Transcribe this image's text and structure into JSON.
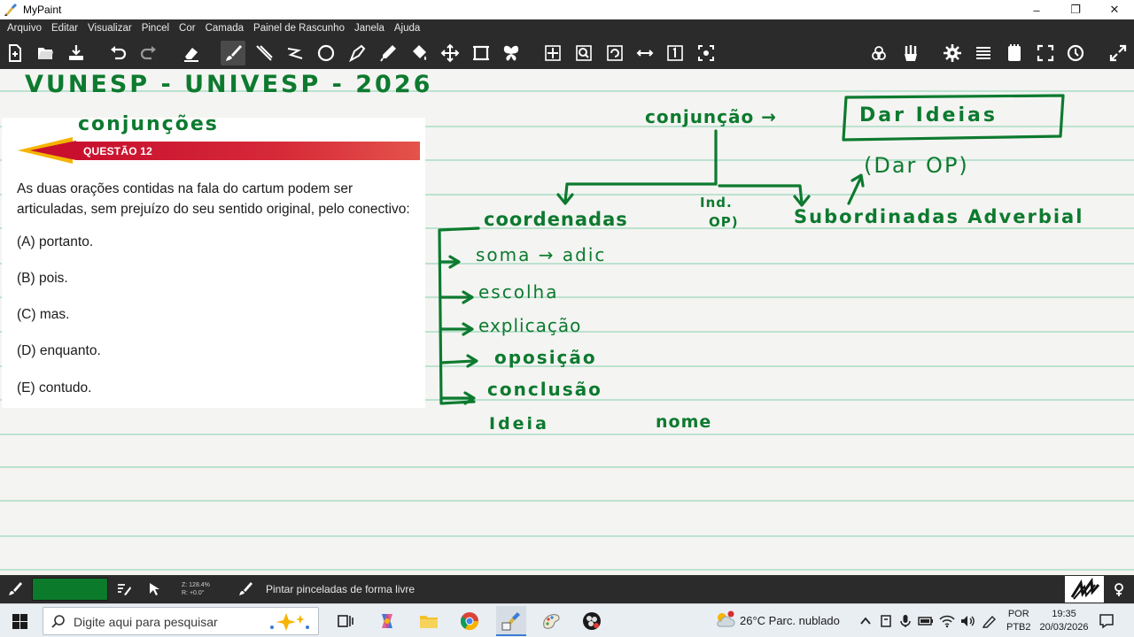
{
  "window": {
    "title": "MyPaint",
    "minimize": "–",
    "restore": "❐",
    "close": "✕"
  },
  "menu": [
    "Arquivo",
    "Editar",
    "Visualizar",
    "Pincel",
    "Cor",
    "Camada",
    "Painel de Rascunho",
    "Janela",
    "Ajuda"
  ],
  "question": {
    "label": "QUESTÃO 12",
    "text": "As duas orações contidas na fala do cartum podem ser articuladas, sem prejuízo do seu sentido original, pelo conectivo:",
    "options": [
      "(A) portanto.",
      "(B) pois.",
      "(C) mas.",
      "(D) enquanto.",
      "(E) contudo."
    ],
    "banner_color": "#c8102e"
  },
  "ink": {
    "color": "#0d7a2f",
    "heading": "VUNESP - UNIVESP - 2026",
    "topic": "conjunções",
    "conjuncao": "conjunção →",
    "dar_ideias": "Dar Ideias",
    "dar_op": "(Dar OP)",
    "coordenadas": "coordenadas",
    "ind_op_1": "Ind.",
    "ind_op_2": "OP)",
    "subordinadas": "Subordinadas Adverbial",
    "items": [
      "soma → adic",
      "escolha",
      "explicação",
      "oposição",
      "conclusão"
    ],
    "ideia": "Ideia",
    "nome": "nome"
  },
  "status": {
    "zoom_line1": "Z: 128.4%",
    "zoom_line2": "R: +0.0°",
    "mode": "Pintar pinceladas de forma livre",
    "color": "#0b7a2b"
  },
  "taskbar": {
    "search_placeholder": "Digite aqui para pesquisar",
    "weather": "26°C  Parc. nublado",
    "lang1": "POR",
    "lang2": "PTB2",
    "time": "19:35",
    "date": "20/03/2026"
  }
}
